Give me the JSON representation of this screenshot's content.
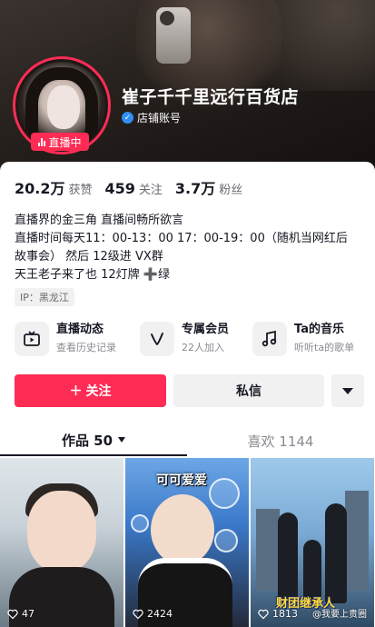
{
  "header": {
    "shop_name": "崔子千千里远行百货店",
    "shop_type": "店铺账号",
    "live_badge": "直播中"
  },
  "stats": [
    {
      "num": "20.2万",
      "label": "获赞"
    },
    {
      "num": "459",
      "label": "关注"
    },
    {
      "num": "3.7万",
      "label": "粉丝"
    }
  ],
  "bio": {
    "lines": [
      "直播界的金三角 直播间畅所欲言",
      "直播时间每天11：00-13：00  17：00-19：00（随机当网红后",
      "故事会）  然后 12级进 VX群",
      "天王老子来了也 12灯牌 ➕绿"
    ],
    "ip": "IP：黑龙江"
  },
  "features": [
    {
      "title": "直播动态",
      "sub": "查看历史记录",
      "icon": "live-replay-icon"
    },
    {
      "title": "专属会员",
      "sub": "22人加入",
      "icon": "member-v-icon"
    },
    {
      "title": "Ta的音乐",
      "sub": "听听ta的歌单",
      "icon": "music-note-icon"
    }
  ],
  "actions": {
    "follow": "关注",
    "message": "私信"
  },
  "tabs": {
    "works": "作品 50",
    "likes": "喜欢 1144"
  },
  "videos": [
    {
      "likes": "47"
    },
    {
      "likes": "2424",
      "caption": "可可爱爱"
    },
    {
      "likes": "1813",
      "caption": "财团继承人",
      "watermark": "@我要上贵圈"
    }
  ],
  "colors": {
    "accent": "#fe2c55",
    "verify": "#2f8ff6"
  }
}
